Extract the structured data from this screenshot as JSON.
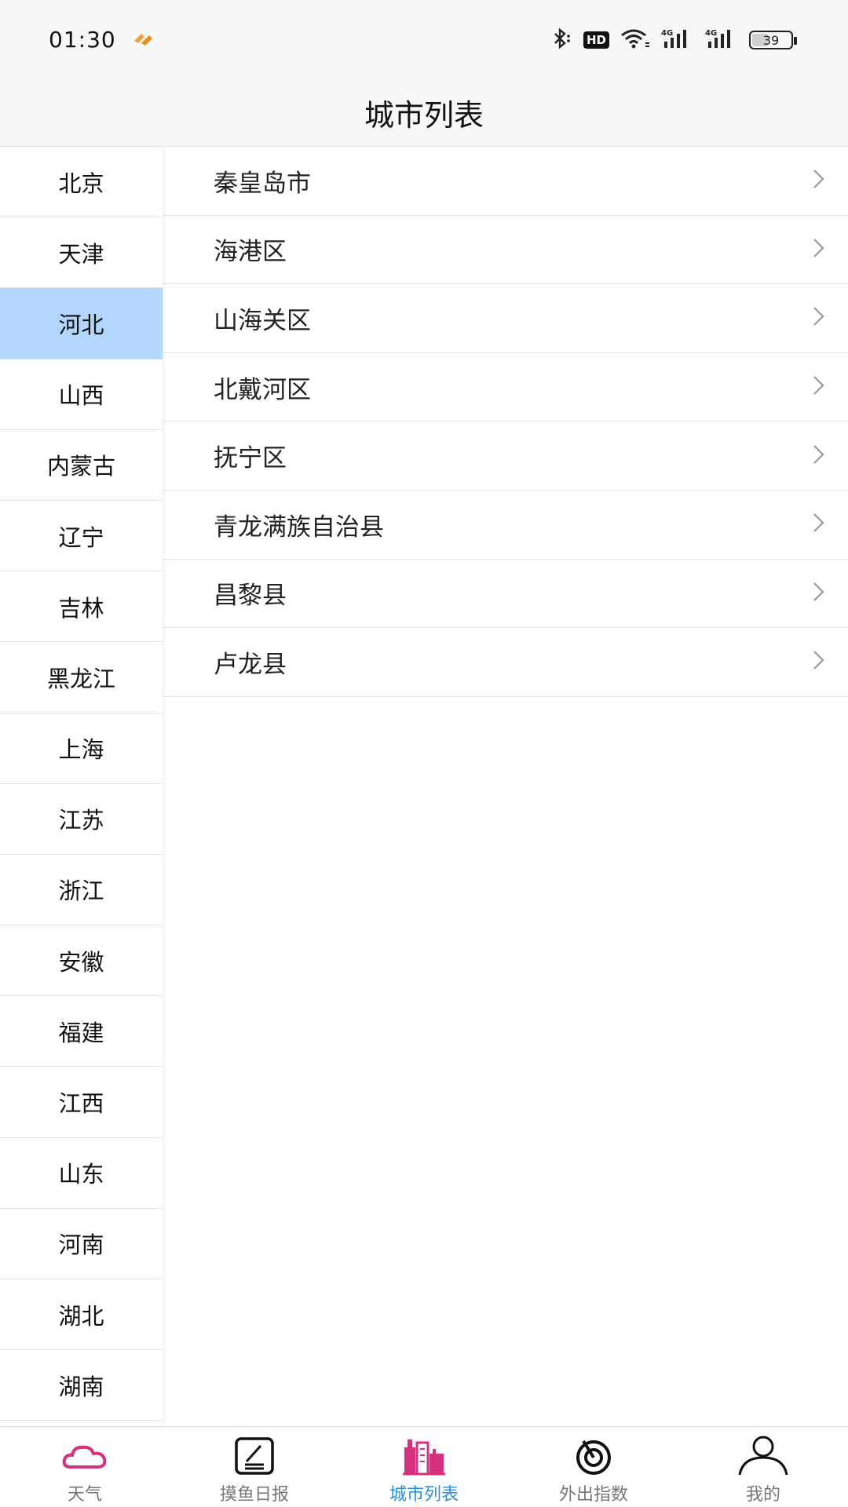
{
  "status_bar": {
    "time": "01:30",
    "hd_label": "HD",
    "battery_level": "39"
  },
  "header": {
    "title": "城市列表"
  },
  "provinces": [
    {
      "label": "北京"
    },
    {
      "label": "天津"
    },
    {
      "label": "河北"
    },
    {
      "label": "山西"
    },
    {
      "label": "内蒙古"
    },
    {
      "label": "辽宁"
    },
    {
      "label": "吉林"
    },
    {
      "label": "黑龙江"
    },
    {
      "label": "上海"
    },
    {
      "label": "江苏"
    },
    {
      "label": "浙江"
    },
    {
      "label": "安徽"
    },
    {
      "label": "福建"
    },
    {
      "label": "江西"
    },
    {
      "label": "山东"
    },
    {
      "label": "河南"
    },
    {
      "label": "湖北"
    },
    {
      "label": "湖南"
    }
  ],
  "selected_province": "河北",
  "cities": [
    {
      "name": "秦皇岛市"
    },
    {
      "name": "海港区"
    },
    {
      "name": "山海关区"
    },
    {
      "name": "北戴河区"
    },
    {
      "name": "抚宁区"
    },
    {
      "name": "青龙满族自治县"
    },
    {
      "name": "昌黎县"
    },
    {
      "name": "卢龙县"
    }
  ],
  "bottom_nav": {
    "weather": "天气",
    "daily": "摸鱼日报",
    "city_list": "城市列表",
    "outing": "外出指数",
    "mine": "我的"
  },
  "colors": {
    "selected_bg": "#b3d6fc",
    "active_tab": "#2b8fd6",
    "weather_icon": "#d6317f",
    "city_icon": "#d6317f"
  }
}
